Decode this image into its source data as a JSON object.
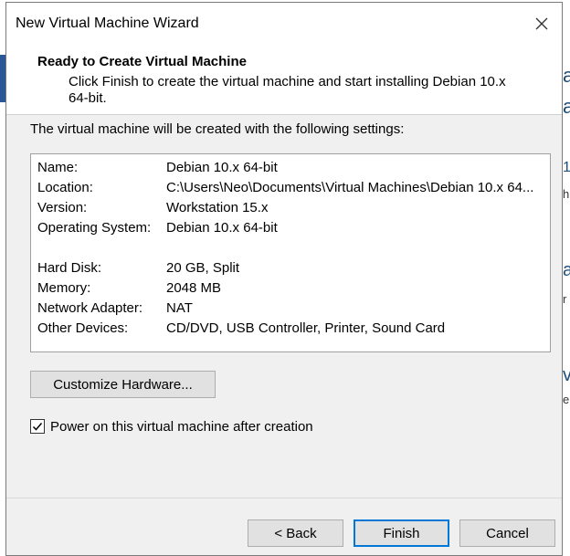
{
  "window": {
    "title": "New Virtual Machine Wizard"
  },
  "header": {
    "title": "Ready to Create Virtual Machine",
    "description": "Click Finish to create the virtual machine and start installing Debian 10.x 64-bit."
  },
  "intro_text": "The virtual machine will be created with the following settings:",
  "settings": [
    {
      "key": "Name:",
      "value": "Debian 10.x 64-bit"
    },
    {
      "key": "Location:",
      "value": "C:\\Users\\Neo\\Documents\\Virtual Machines\\Debian 10.x 64..."
    },
    {
      "key": "Version:",
      "value": "Workstation 15.x"
    },
    {
      "key": "Operating System:",
      "value": "Debian 10.x 64-bit"
    },
    {
      "key": "Hard Disk:",
      "value": "20 GB, Split"
    },
    {
      "key": "Memory:",
      "value": "2048 MB"
    },
    {
      "key": "Network Adapter:",
      "value": "NAT"
    },
    {
      "key": "Other Devices:",
      "value": "CD/DVD, USB Controller, Printer, Sound Card"
    }
  ],
  "customize_button": "Customize Hardware...",
  "power_on": {
    "label": "Power on this virtual machine after creation",
    "checked": true
  },
  "buttons": {
    "back": "< Back",
    "finish": "Finish",
    "cancel": "Cancel"
  },
  "icons": {
    "close": "close-icon",
    "checkmark": "checkmark-icon"
  },
  "colors": {
    "default_button_border": "#0078d7",
    "dialog_bg": "#f0f0f0"
  },
  "background_app": {
    "glyphs": [
      "a",
      "a",
      "1",
      "hi",
      "a",
      "r",
      "v",
      "e"
    ]
  }
}
